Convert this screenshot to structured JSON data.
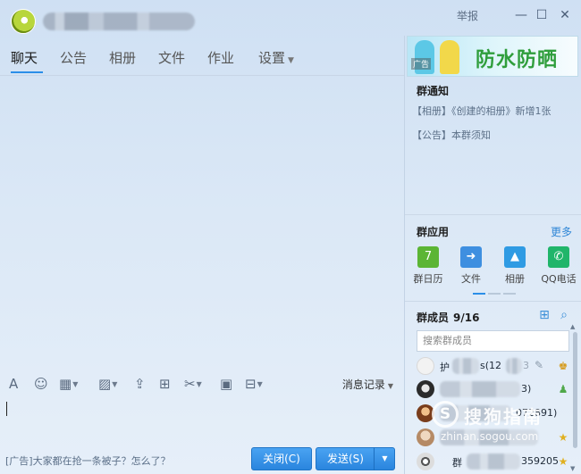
{
  "titlebar": {
    "report": "举报",
    "minimize_glyph": "—",
    "maximize_glyph": "☐",
    "close_glyph": "✕"
  },
  "tabs": [
    {
      "label": "聊天",
      "active": true
    },
    {
      "label": "公告"
    },
    {
      "label": "相册"
    },
    {
      "label": "文件"
    },
    {
      "label": "作业"
    },
    {
      "label": "设置",
      "dropdown": true
    }
  ],
  "toolbar": {
    "history_label": "消息记录",
    "icons": [
      "font-icon",
      "emoji-icon",
      "gif-icon",
      "image-icon",
      "upload-icon",
      "gift-icon",
      "screenshot-icon",
      "shake-icon",
      "more-icon"
    ]
  },
  "bottom": {
    "ad_text": "[广告]大家都在抢一条被子？怎么了？",
    "close_button": "关闭(C)",
    "send_button": "发送(S)"
  },
  "sidebar": {
    "ad": {
      "tag": "广告",
      "slogan": "防水防晒"
    },
    "notice": {
      "title": "群通知",
      "lines": [
        "【相册】《创建的相册》新增1张",
        "【公告】本群须知"
      ]
    },
    "apps": {
      "title": "群应用",
      "more": "更多",
      "items": [
        {
          "label": "群日历",
          "icon": "calendar-icon",
          "color": "#5bb534",
          "glyph": "7"
        },
        {
          "label": "文件",
          "icon": "file-icon",
          "color": "#3e8fe0",
          "glyph": "➜"
        },
        {
          "label": "相册",
          "icon": "album-icon",
          "color": "#2f9be3",
          "glyph": "▲"
        },
        {
          "label": "QQ电话",
          "icon": "phone-icon",
          "color": "#20b56a",
          "glyph": "✆"
        }
      ]
    },
    "members": {
      "title": "群成员",
      "count": "9/16",
      "search_placeholder": "搜索群成员",
      "rows": [
        {
          "name": "护",
          "suffix": "s(12",
          "tail": "3"
        },
        {
          "name": "",
          "suffix": "",
          "tail": "3)"
        },
        {
          "name": "",
          "suffix": "",
          "tail": "072891)"
        },
        {
          "name": "",
          "suffix": "",
          "tail": ""
        },
        {
          "name": "群",
          "suffix": "",
          "tail": "359205"
        }
      ]
    }
  },
  "watermark": {
    "glyph": "S",
    "text": "搜狗指南",
    "url": "zhinan.sogou.com"
  }
}
